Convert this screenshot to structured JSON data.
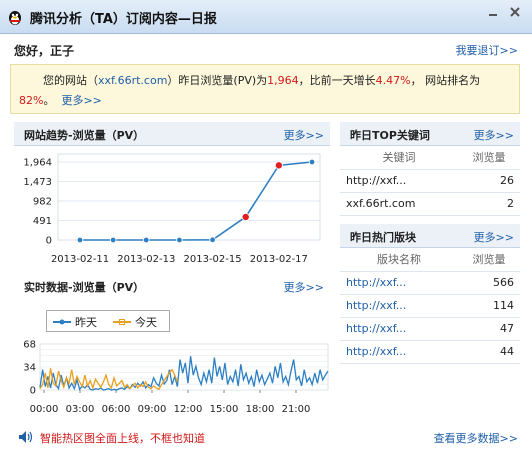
{
  "window": {
    "title": "腾讯分析（TA）订阅内容—日报"
  },
  "greeting": "您好，正子",
  "unsubscribe_link": "我要退订>>",
  "summary": {
    "p1": "您的网站（",
    "site": "xxf.66rt.com",
    "p2": "）昨日浏览量(PV)为",
    "pv": "1,964",
    "p3": "，比前一天增长",
    "growth": "4.47%",
    "p4": "，  网站排名为",
    "rank": "82%",
    "p5": "。",
    "more": "更多>>"
  },
  "trend": {
    "title": "网站趋势-浏览量（PV）",
    "more": "更多>>"
  },
  "realtime": {
    "title": "实时数据-浏览量（PV）",
    "more": "更多>>",
    "legend": [
      "昨天",
      "今天"
    ]
  },
  "top_keywords": {
    "title": "昨日TOP关键词",
    "more": "更多>>",
    "headers": [
      "关键词",
      "浏览量"
    ],
    "rows": [
      {
        "k": "http://xxf...",
        "v": "26"
      },
      {
        "k": "xxf.66rt.com",
        "v": "2"
      }
    ]
  },
  "hot_pages": {
    "title": "昨日热门版块",
    "more": "更多>>",
    "headers": [
      "版块名称",
      "浏览量"
    ],
    "rows": [
      {
        "k": "http://xxf...",
        "v": "566"
      },
      {
        "k": "http://xxf...",
        "v": "114"
      },
      {
        "k": "http://xxf...",
        "v": "47"
      },
      {
        "k": "http://xxf...",
        "v": "44"
      }
    ]
  },
  "footer": {
    "notice": "智能热区图全面上线，不框也知道",
    "more": "查看更多数据>>"
  },
  "chart_data": [
    {
      "type": "line",
      "title": "网站趋势-浏览量（PV）",
      "x": [
        "2013-02-11",
        "2013-02-12",
        "2013-02-13",
        "2013-02-14",
        "2013-02-15",
        "2013-02-16",
        "2013-02-17",
        "2013-02-18"
      ],
      "x_tick_labels": [
        "2013-02-11",
        "2013-02-13",
        "2013-02-15",
        "2013-02-17"
      ],
      "y_ticks": [
        "0",
        "491",
        "982",
        "1,473",
        "1,964"
      ],
      "ylim": [
        0,
        1964
      ],
      "values": [
        0,
        0,
        0,
        0,
        5,
        580,
        1880,
        1964
      ],
      "highlight_points": [
        5,
        6
      ],
      "grid": true,
      "colors": {
        "line": "#2c7fc4",
        "point": "#2c7fc4",
        "highlight": "#e02020"
      }
    },
    {
      "type": "line",
      "title": "实时数据-浏览量（PV）",
      "x_ticks": [
        "00:00",
        "03:00",
        "06:00",
        "09:00",
        "12:00",
        "15:00",
        "18:00",
        "21:00"
      ],
      "y_ticks": [
        "0",
        "34",
        "68"
      ],
      "ylim": [
        0,
        68
      ],
      "grid": true,
      "legend_position": "top-left",
      "series": [
        {
          "name": "昨天",
          "color": "#2c7fc4",
          "values": [
            4,
            30,
            5,
            20,
            3,
            25,
            8,
            2,
            22,
            6,
            18,
            3,
            10,
            2,
            15,
            1,
            6,
            3,
            8,
            1,
            0,
            2,
            1,
            3,
            0,
            1,
            2,
            0,
            1,
            0,
            2,
            3,
            1,
            5,
            2,
            8,
            4,
            10,
            6,
            12,
            3,
            8,
            5,
            18,
            10,
            6,
            22,
            9,
            14,
            30,
            8,
            20,
            5,
            45,
            25,
            40,
            10,
            50,
            22,
            35,
            18,
            8,
            25,
            12,
            30,
            10,
            48,
            20,
            35,
            15,
            40,
            8,
            20,
            12,
            30,
            6,
            38,
            15,
            25,
            10,
            20,
            5,
            30,
            12,
            22,
            8,
            16,
            25,
            10,
            35,
            18,
            40,
            12,
            20,
            8,
            28,
            45,
            15,
            20,
            6,
            30,
            12,
            18,
            8,
            25,
            10,
            30,
            15,
            22,
            28
          ]
        },
        {
          "name": "今天",
          "color": "#e8a020",
          "values": [
            2,
            8,
            25,
            3,
            32,
            10,
            6,
            28,
            14,
            4,
            18,
            10,
            30,
            8,
            20,
            12,
            5,
            22,
            6,
            14,
            3,
            16,
            10,
            4,
            12,
            22,
            8,
            3,
            18,
            6,
            10,
            14,
            4,
            8,
            2,
            6,
            10,
            3,
            8,
            5,
            12,
            4,
            2,
            6,
            3,
            1,
            8,
            14,
            20,
            26,
            30,
            22,
            12
          ]
        }
      ]
    }
  ]
}
